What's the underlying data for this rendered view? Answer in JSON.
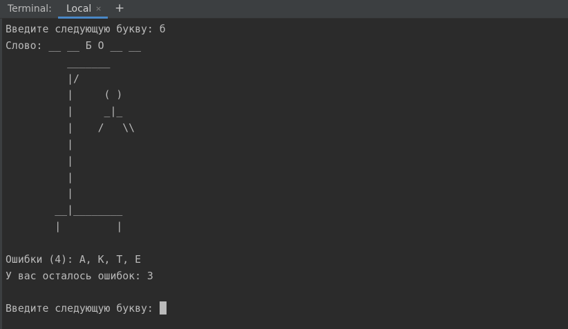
{
  "toolwindow": {
    "title": "Terminal:",
    "tabs": [
      {
        "label": "Local",
        "close_glyph": "×"
      }
    ],
    "new_tab_glyph": "+"
  },
  "terminal": {
    "lines": [
      "Введите следующую букву: б",
      "Слово: __ __ Б О __ __",
      "          _______",
      "          |/",
      "          |     ( )",
      "          |     _|_",
      "          |    /   \\\\",
      "          |",
      "          |",
      "          |",
      "          |",
      "        __|________",
      "        |         |",
      "",
      "Ошибки (4): А, К, Т, Е",
      "У вас осталось ошибок: 3",
      ""
    ],
    "prompt": "Введите следующую букву: "
  },
  "colors": {
    "background": "#2b2b2b",
    "tabbar": "#3c3f41",
    "tab_underline": "#4a88c7",
    "text": "#bbbbbb",
    "cursor": "#bbbbbb"
  }
}
